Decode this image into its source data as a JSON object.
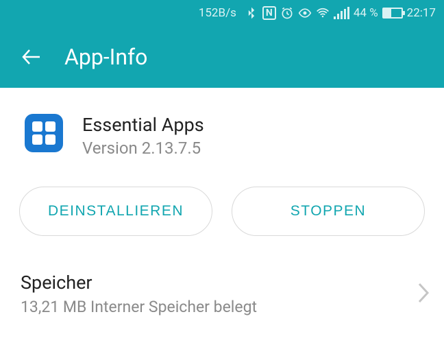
{
  "status_bar": {
    "speed": "152B/s",
    "battery_percent": "44 %",
    "time": "22:17"
  },
  "header": {
    "title": "App-Info"
  },
  "app": {
    "name": "Essential Apps",
    "version": "Version 2.13.7.5"
  },
  "buttons": {
    "uninstall": "DEINSTALLIEREN",
    "stop": "STOPPEN"
  },
  "storage": {
    "title": "Speicher",
    "subtitle": "13,21 MB Interner Speicher belegt"
  }
}
